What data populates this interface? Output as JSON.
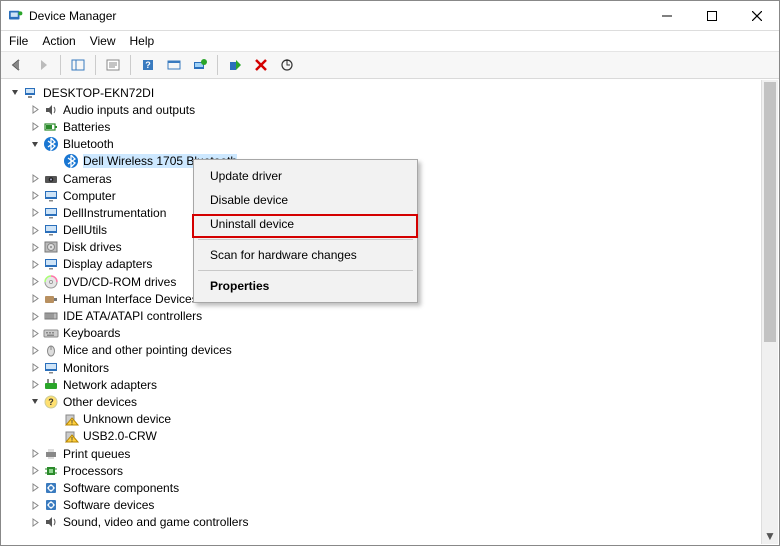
{
  "window": {
    "title": "Device Manager"
  },
  "menubar": {
    "file": "File",
    "action": "Action",
    "view": "View",
    "help": "Help"
  },
  "tree": {
    "root": "DESKTOP-EKN72DI",
    "nodes": [
      {
        "label": "Audio inputs and outputs",
        "state": "collapsed",
        "icon": "audio"
      },
      {
        "label": "Batteries",
        "state": "collapsed",
        "icon": "battery"
      },
      {
        "label": "Bluetooth",
        "state": "expanded",
        "icon": "bluetooth",
        "children": [
          {
            "label": "Dell Wireless 1705 Bluetooth",
            "icon": "bluetooth",
            "selected": true
          }
        ]
      },
      {
        "label": "Cameras",
        "state": "collapsed",
        "icon": "camera"
      },
      {
        "label": "Computer",
        "state": "collapsed",
        "icon": "monitor"
      },
      {
        "label": "DellInstrumentation",
        "state": "collapsed",
        "icon": "monitor"
      },
      {
        "label": "DellUtils",
        "state": "collapsed",
        "icon": "monitor"
      },
      {
        "label": "Disk drives",
        "state": "collapsed",
        "icon": "disk"
      },
      {
        "label": "Display adapters",
        "state": "collapsed",
        "icon": "monitor"
      },
      {
        "label": "DVD/CD-ROM drives",
        "state": "collapsed",
        "icon": "cd"
      },
      {
        "label": "Human Interface Devices",
        "state": "collapsed",
        "icon": "hid"
      },
      {
        "label": "IDE ATA/ATAPI controllers",
        "state": "collapsed",
        "icon": "ide"
      },
      {
        "label": "Keyboards",
        "state": "collapsed",
        "icon": "keyboard"
      },
      {
        "label": "Mice and other pointing devices",
        "state": "collapsed",
        "icon": "mouse"
      },
      {
        "label": "Monitors",
        "state": "collapsed",
        "icon": "monitor"
      },
      {
        "label": "Network adapters",
        "state": "collapsed",
        "icon": "network"
      },
      {
        "label": "Other devices",
        "state": "expanded",
        "icon": "other",
        "children": [
          {
            "label": "Unknown device",
            "icon": "warn"
          },
          {
            "label": "USB2.0-CRW",
            "icon": "warn"
          }
        ]
      },
      {
        "label": "Print queues",
        "state": "collapsed",
        "icon": "printer"
      },
      {
        "label": "Processors",
        "state": "collapsed",
        "icon": "cpu"
      },
      {
        "label": "Software components",
        "state": "collapsed",
        "icon": "software"
      },
      {
        "label": "Software devices",
        "state": "collapsed",
        "icon": "software"
      },
      {
        "label": "Sound, video and game controllers",
        "state": "collapsed",
        "icon": "audio"
      }
    ]
  },
  "context_menu": {
    "update": "Update driver",
    "disable": "Disable device",
    "uninstall": "Uninstall device",
    "scan": "Scan for hardware changes",
    "properties": "Properties"
  }
}
